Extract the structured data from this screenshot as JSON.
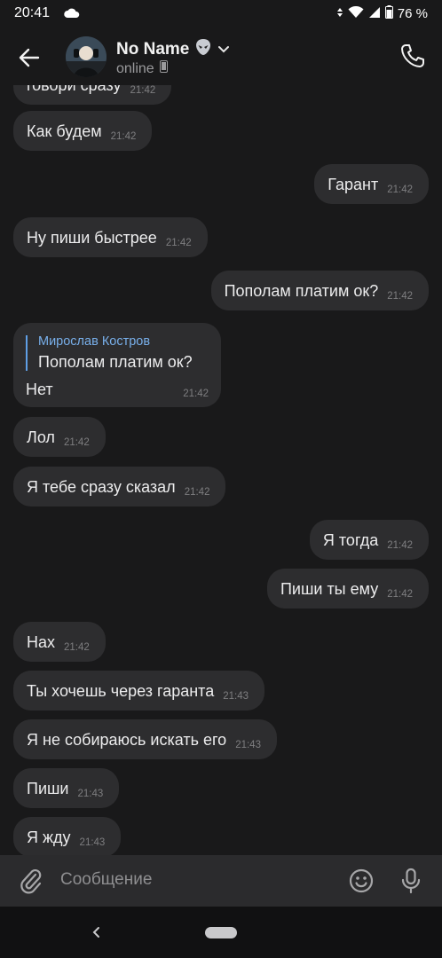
{
  "status_bar": {
    "time": "20:41",
    "battery": "76 %"
  },
  "header": {
    "name": "No Name",
    "status": "online"
  },
  "composer": {
    "placeholder": "Сообщение"
  },
  "messages": [
    {
      "text": "говори сразу",
      "time": "21:42",
      "side": "in"
    },
    {
      "text": "Как будем",
      "time": "21:42",
      "side": "in"
    },
    {
      "text": "Гарант",
      "time": "21:42",
      "side": "out"
    },
    {
      "text": "Ну пиши быстрее",
      "time": "21:42",
      "side": "in"
    },
    {
      "text": "Пополам платим ок?",
      "time": "21:42",
      "side": "out"
    },
    {
      "reply_author": "Мирослав Костров",
      "reply_quote": "Пополам платим ок?",
      "text": "Нет",
      "time": "21:42",
      "side": "in"
    },
    {
      "text": "Лол",
      "time": "21:42",
      "side": "in"
    },
    {
      "text": "Я тебе сразу сказал",
      "time": "21:42",
      "side": "in"
    },
    {
      "text": "Я тогда",
      "time": "21:42",
      "side": "out"
    },
    {
      "text": "Пиши ты ему",
      "time": "21:42",
      "side": "out"
    },
    {
      "text": "Нах",
      "time": "21:42",
      "side": "in"
    },
    {
      "text": "Ты хочешь через гаранта",
      "time": "21:43",
      "side": "in"
    },
    {
      "text": "Я не собираюсь искать его",
      "time": "21:43",
      "side": "in"
    },
    {
      "text": "Пиши",
      "time": "21:43",
      "side": "in"
    },
    {
      "text": "Я жду",
      "time": "21:43",
      "side": "in"
    }
  ]
}
